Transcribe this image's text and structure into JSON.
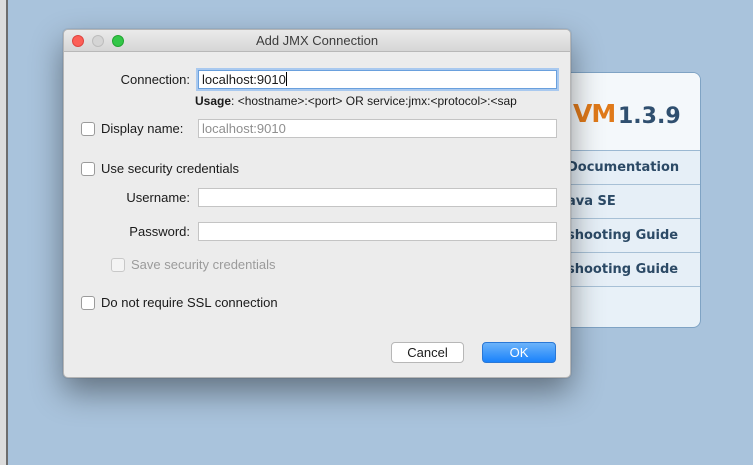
{
  "background": {
    "brand": {
      "word": "VM",
      "version": "1.3.9"
    },
    "links": [
      {
        "label": "Documentation"
      },
      {
        "label": "ava SE"
      },
      {
        "label": "shooting Guide"
      },
      {
        "label": "shooting Guide"
      }
    ]
  },
  "dialog": {
    "title": "Add JMX Connection",
    "connection": {
      "label": "Connection:",
      "value": "localhost:9010"
    },
    "usage": {
      "label": "Usage",
      "text": ": <hostname>:<port> OR service:jmx:<protocol>:<sap"
    },
    "display_name": {
      "label": "Display name:",
      "checked": false,
      "placeholder": "localhost:9010"
    },
    "use_security": {
      "label": "Use security credentials",
      "checked": false
    },
    "username": {
      "label": "Username:",
      "value": ""
    },
    "password": {
      "label": "Password:",
      "value": ""
    },
    "save_security": {
      "label": "Save security credentials",
      "checked": false,
      "enabled": false
    },
    "no_ssl": {
      "label": "Do not require SSL connection",
      "checked": false
    },
    "buttons": {
      "cancel": "Cancel",
      "ok": "OK"
    }
  },
  "colors": {
    "desktop": "#a9c3dc",
    "accent": "#1a82fb",
    "brand_orange": "#e07a1a",
    "close": "#fc5f57",
    "maximize": "#33c748"
  }
}
